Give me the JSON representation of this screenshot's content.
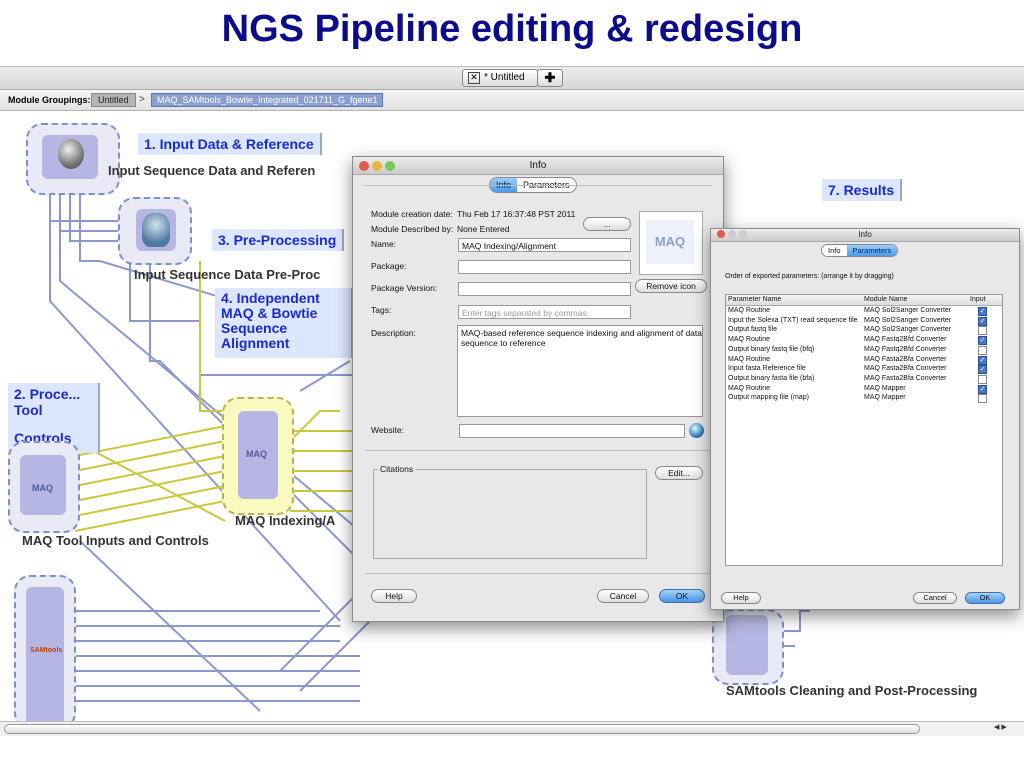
{
  "slide": {
    "title": "NGS Pipeline editing & redesign"
  },
  "tabs": {
    "active": "* Untitled",
    "close_glyph": "✕",
    "add_glyph": "✚"
  },
  "breadcrumb": {
    "label": "Module Groupings:",
    "items": [
      "Untitled",
      "MAQ_SAMtools_Bowtie_Integrated_021711_G_fgene1"
    ],
    "separator": ">"
  },
  "canvas": {
    "group_labels": {
      "g1": "1. Input Data & Reference",
      "g2_line1": "2. Proce...",
      "g2_line2": "Tool",
      "g2_line3": "Controls",
      "g3": "3. Pre-Processing",
      "g4_line1": "4. Independent",
      "g4_line2": "MAQ & Bowtie",
      "g4_line3": "Sequence",
      "g4_line4": "Alignment",
      "g7": "7. Results"
    },
    "module_labels": {
      "input_data": "Input Sequence Data and Referen",
      "preproc": "Input Sequence Data Pre-Proc",
      "maq_index": "MAQ Indexing/A",
      "maq_tool": "MAQ Tool Inputs and Controls",
      "samtools": "SAMtools Cleaning and Post-Processing"
    },
    "node_texts": {
      "maq": "MAQ",
      "samtools": "SAMtools"
    }
  },
  "info_dialog": {
    "title": "Info",
    "tabs": [
      "Info",
      "Parameters"
    ],
    "active_tab": "Info",
    "fields": {
      "creation_label": "Module creation date:",
      "creation_value": "Thu Feb 17 16:37:48 PST 2011",
      "described_label": "Module Described by:",
      "described_value": "None Entered",
      "name_label": "Name:",
      "name_value": "MAQ Indexing/Alignment",
      "package_label": "Package:",
      "package_value": "",
      "version_label": "Package Version:",
      "version_value": "",
      "tags_label": "Tags:",
      "tags_placeholder": "Enter tags separated by commas.",
      "description_label": "Description:",
      "description_value": "MAQ-based reference sequence indexing and alignment of data sequence to reference",
      "website_label": "Website:",
      "website_value": ""
    },
    "icon_button": "...",
    "icon_preview": "MAQ",
    "remove_icon": "Remove icon",
    "citations_label": "Citations",
    "edit_button": "Edit...",
    "help_button": "Help",
    "cancel_button": "Cancel",
    "ok_button": "OK"
  },
  "params_dialog": {
    "title": "Info",
    "tabs": [
      "Info",
      "Parameters"
    ],
    "active_tab": "Parameters",
    "instruction": "Order of exported parameters: (arrange it by dragging)",
    "columns": [
      "Parameter Name",
      "Module Name",
      "Input"
    ],
    "rows": [
      {
        "param": "MAQ Routine",
        "module": "MAQ Sol2Sanger Converter",
        "input": true
      },
      {
        "param": "Input the Solexa (TXT) read sequence file",
        "module": "MAQ Sol2Sanger Converter",
        "input": true
      },
      {
        "param": "Output fastq file",
        "module": "MAQ Sol2Sanger Converter",
        "input": false
      },
      {
        "param": "MAQ Routine",
        "module": "MAQ Fastq2Bfd Converter",
        "input": true
      },
      {
        "param": "Output binary fastq file (bfq)",
        "module": "MAQ Fastq2Bfd Converter",
        "input": false
      },
      {
        "param": "MAQ Routine",
        "module": "MAQ Fasta2Bfa Converter",
        "input": true
      },
      {
        "param": "Input fasta Reference file",
        "module": "MAQ Fasta2Bfa Converter",
        "input": true
      },
      {
        "param": "Output binary fasta file (bfa)",
        "module": "MAQ Fasta2Bfa Converter",
        "input": false
      },
      {
        "param": "MAQ Routine",
        "module": "MAQ Mapper",
        "input": true
      },
      {
        "param": "Output mapping file (map)",
        "module": "MAQ Mapper",
        "input": false
      }
    ],
    "help_button": "Help",
    "cancel_button": "Cancel",
    "ok_button": "OK"
  },
  "colors": {
    "title": "#0c0c8a",
    "group_label": "#1a2acc",
    "blue_wire": "#8c98cc",
    "yellow_wire": "#c8c83c",
    "accent_button": "#4a96e6"
  }
}
